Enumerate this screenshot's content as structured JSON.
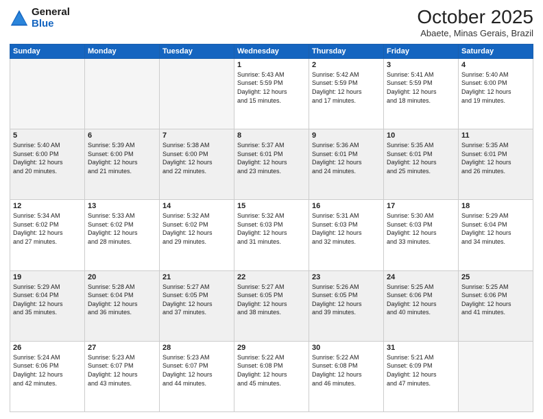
{
  "header": {
    "logo_line1": "General",
    "logo_line2": "Blue",
    "month_title": "October 2025",
    "location": "Abaete, Minas Gerais, Brazil"
  },
  "weekdays": [
    "Sunday",
    "Monday",
    "Tuesday",
    "Wednesday",
    "Thursday",
    "Friday",
    "Saturday"
  ],
  "weeks": [
    [
      {
        "day": "",
        "info": ""
      },
      {
        "day": "",
        "info": ""
      },
      {
        "day": "",
        "info": ""
      },
      {
        "day": "1",
        "info": "Sunrise: 5:43 AM\nSunset: 5:59 PM\nDaylight: 12 hours\nand 15 minutes."
      },
      {
        "day": "2",
        "info": "Sunrise: 5:42 AM\nSunset: 5:59 PM\nDaylight: 12 hours\nand 17 minutes."
      },
      {
        "day": "3",
        "info": "Sunrise: 5:41 AM\nSunset: 5:59 PM\nDaylight: 12 hours\nand 18 minutes."
      },
      {
        "day": "4",
        "info": "Sunrise: 5:40 AM\nSunset: 6:00 PM\nDaylight: 12 hours\nand 19 minutes."
      }
    ],
    [
      {
        "day": "5",
        "info": "Sunrise: 5:40 AM\nSunset: 6:00 PM\nDaylight: 12 hours\nand 20 minutes."
      },
      {
        "day": "6",
        "info": "Sunrise: 5:39 AM\nSunset: 6:00 PM\nDaylight: 12 hours\nand 21 minutes."
      },
      {
        "day": "7",
        "info": "Sunrise: 5:38 AM\nSunset: 6:00 PM\nDaylight: 12 hours\nand 22 minutes."
      },
      {
        "day": "8",
        "info": "Sunrise: 5:37 AM\nSunset: 6:01 PM\nDaylight: 12 hours\nand 23 minutes."
      },
      {
        "day": "9",
        "info": "Sunrise: 5:36 AM\nSunset: 6:01 PM\nDaylight: 12 hours\nand 24 minutes."
      },
      {
        "day": "10",
        "info": "Sunrise: 5:35 AM\nSunset: 6:01 PM\nDaylight: 12 hours\nand 25 minutes."
      },
      {
        "day": "11",
        "info": "Sunrise: 5:35 AM\nSunset: 6:01 PM\nDaylight: 12 hours\nand 26 minutes."
      }
    ],
    [
      {
        "day": "12",
        "info": "Sunrise: 5:34 AM\nSunset: 6:02 PM\nDaylight: 12 hours\nand 27 minutes."
      },
      {
        "day": "13",
        "info": "Sunrise: 5:33 AM\nSunset: 6:02 PM\nDaylight: 12 hours\nand 28 minutes."
      },
      {
        "day": "14",
        "info": "Sunrise: 5:32 AM\nSunset: 6:02 PM\nDaylight: 12 hours\nand 29 minutes."
      },
      {
        "day": "15",
        "info": "Sunrise: 5:32 AM\nSunset: 6:03 PM\nDaylight: 12 hours\nand 31 minutes."
      },
      {
        "day": "16",
        "info": "Sunrise: 5:31 AM\nSunset: 6:03 PM\nDaylight: 12 hours\nand 32 minutes."
      },
      {
        "day": "17",
        "info": "Sunrise: 5:30 AM\nSunset: 6:03 PM\nDaylight: 12 hours\nand 33 minutes."
      },
      {
        "day": "18",
        "info": "Sunrise: 5:29 AM\nSunset: 6:04 PM\nDaylight: 12 hours\nand 34 minutes."
      }
    ],
    [
      {
        "day": "19",
        "info": "Sunrise: 5:29 AM\nSunset: 6:04 PM\nDaylight: 12 hours\nand 35 minutes."
      },
      {
        "day": "20",
        "info": "Sunrise: 5:28 AM\nSunset: 6:04 PM\nDaylight: 12 hours\nand 36 minutes."
      },
      {
        "day": "21",
        "info": "Sunrise: 5:27 AM\nSunset: 6:05 PM\nDaylight: 12 hours\nand 37 minutes."
      },
      {
        "day": "22",
        "info": "Sunrise: 5:27 AM\nSunset: 6:05 PM\nDaylight: 12 hours\nand 38 minutes."
      },
      {
        "day": "23",
        "info": "Sunrise: 5:26 AM\nSunset: 6:05 PM\nDaylight: 12 hours\nand 39 minutes."
      },
      {
        "day": "24",
        "info": "Sunrise: 5:25 AM\nSunset: 6:06 PM\nDaylight: 12 hours\nand 40 minutes."
      },
      {
        "day": "25",
        "info": "Sunrise: 5:25 AM\nSunset: 6:06 PM\nDaylight: 12 hours\nand 41 minutes."
      }
    ],
    [
      {
        "day": "26",
        "info": "Sunrise: 5:24 AM\nSunset: 6:06 PM\nDaylight: 12 hours\nand 42 minutes."
      },
      {
        "day": "27",
        "info": "Sunrise: 5:23 AM\nSunset: 6:07 PM\nDaylight: 12 hours\nand 43 minutes."
      },
      {
        "day": "28",
        "info": "Sunrise: 5:23 AM\nSunset: 6:07 PM\nDaylight: 12 hours\nand 44 minutes."
      },
      {
        "day": "29",
        "info": "Sunrise: 5:22 AM\nSunset: 6:08 PM\nDaylight: 12 hours\nand 45 minutes."
      },
      {
        "day": "30",
        "info": "Sunrise: 5:22 AM\nSunset: 6:08 PM\nDaylight: 12 hours\nand 46 minutes."
      },
      {
        "day": "31",
        "info": "Sunrise: 5:21 AM\nSunset: 6:09 PM\nDaylight: 12 hours\nand 47 minutes."
      },
      {
        "day": "",
        "info": ""
      }
    ]
  ]
}
